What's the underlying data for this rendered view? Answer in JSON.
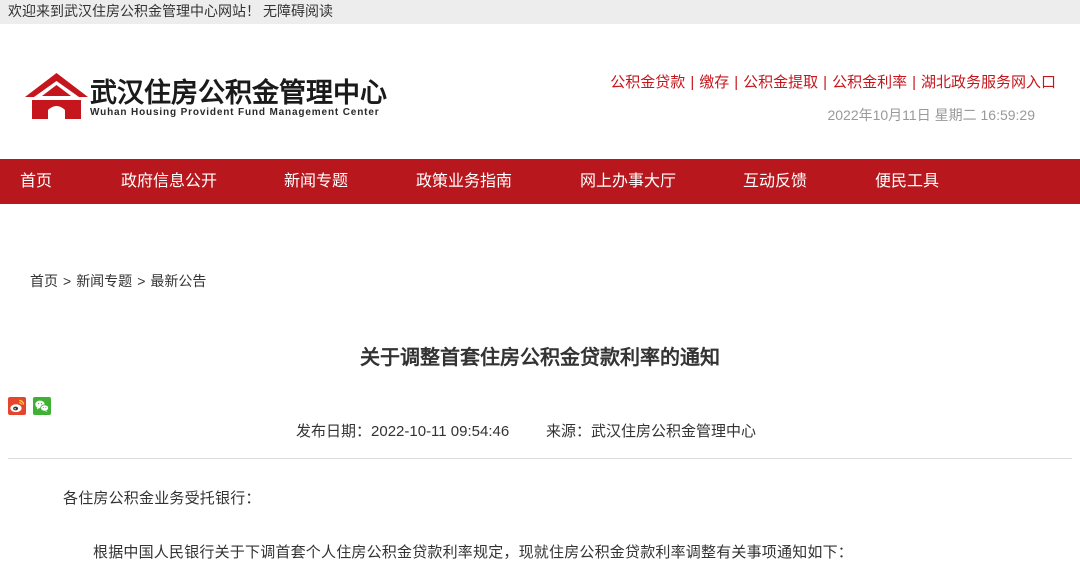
{
  "topbar": {
    "welcome": "欢迎来到武汉住房公积金管理中心网站！",
    "accessibility": "无障碍阅读"
  },
  "header": {
    "logo_cn": "武汉住房公积金管理中心",
    "logo_en": "Wuhan Housing Provident Fund Management Center",
    "logo_icon": "house-logo-icon",
    "quick_links": [
      "公积金贷款",
      "缴存",
      "公积金提取",
      "公积金利率",
      "湖北政务服务网入口"
    ],
    "link_separator": "|",
    "datetime": "2022年10月11日 星期二 16:59:29"
  },
  "nav": {
    "items": [
      "首页",
      "政府信息公开",
      "新闻专题",
      "政策业务指南",
      "网上办事大厅",
      "互动反馈",
      "便民工具"
    ]
  },
  "breadcrumb": {
    "items": [
      "首页",
      "新闻专题",
      "最新公告"
    ],
    "separator": ">"
  },
  "share": {
    "icons": [
      "weibo-icon",
      "wechat-icon"
    ]
  },
  "article": {
    "title": "关于调整首套住房公积金贷款利率的通知",
    "publish_label": "发布日期：",
    "publish_date": "2022-10-11 09:54:46",
    "source_label": "来源：",
    "source": "武汉住房公积金管理中心",
    "paragraphs": [
      "各住房公积金业务受托银行：",
      "根据中国人民银行关于下调首套个人住房公积金贷款利率规定，现就住房公积金贷款利率调整有关事项通知如下："
    ]
  },
  "colors": {
    "nav_background": "#b8171d",
    "link_red": "#c5161d",
    "logo_red": "#c5161d",
    "topbar_background": "#ededed",
    "date_gray": "#999999",
    "body_text": "#333333",
    "divider": "#dddddd"
  }
}
